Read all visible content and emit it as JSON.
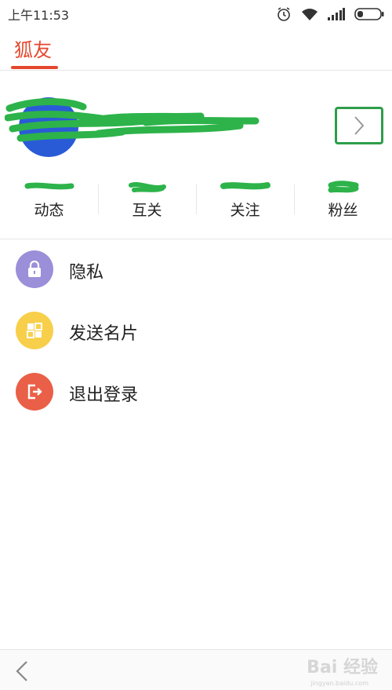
{
  "status_bar": {
    "time": "上午11:53",
    "icons": [
      "alarm-icon",
      "wifi-icon",
      "signal-icon",
      "battery-icon"
    ]
  },
  "header": {
    "title": "狐友",
    "accent_color": "#e4472e"
  },
  "profile": {
    "avatar_color": "#2a5bd7",
    "redaction_color": "#2db34a",
    "stats": [
      {
        "label": "动态"
      },
      {
        "label": "互关"
      },
      {
        "label": "关注"
      },
      {
        "label": "粉丝"
      }
    ]
  },
  "menu": {
    "items": [
      {
        "label": "隐私",
        "icon": "lock-icon",
        "color": "#9a8fd8"
      },
      {
        "label": "发送名片",
        "icon": "qr-card-icon",
        "color": "#f7cf4a"
      },
      {
        "label": "退出登录",
        "icon": "logout-icon",
        "color": "#ea5f47"
      }
    ]
  },
  "bottom_bar": {
    "watermark": "Bai 经验",
    "watermark_sub": "jingyan.baidu.com"
  }
}
